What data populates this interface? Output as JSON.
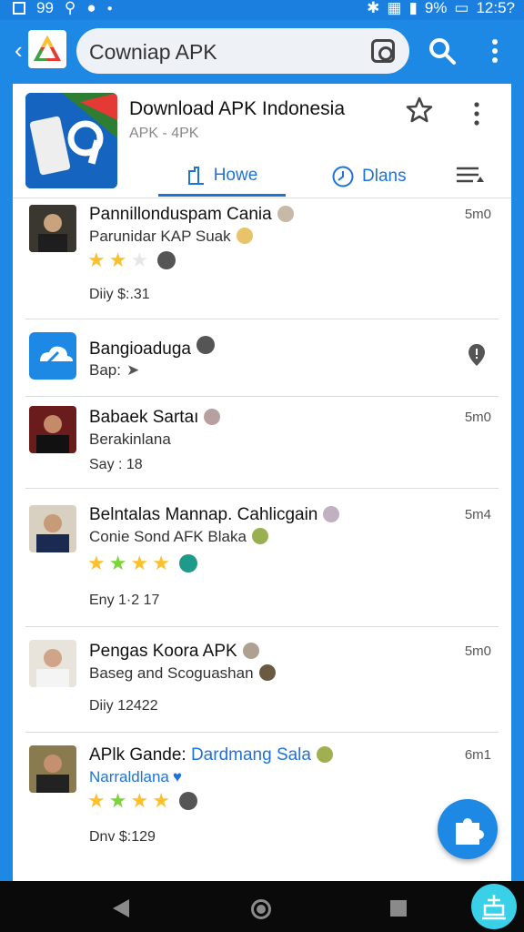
{
  "status_bar": {
    "notif_count": "99",
    "time": "12:5?",
    "battery": "9%"
  },
  "search": {
    "value": "Cowniap APK"
  },
  "app": {
    "title": "Download APK Indonesia",
    "subtitle": "APK - 4PK"
  },
  "tabs": [
    {
      "label": "Howe",
      "icon": "home-icon"
    },
    {
      "label": "Dlans",
      "icon": "clock-icon"
    }
  ],
  "items": [
    {
      "title": "Pannillonduspam Cania",
      "subtitle": "Parunidar KAP Suak",
      "meta": "Diiy $:.31",
      "time": "5m0",
      "stars": [
        "y",
        "y",
        "e"
      ]
    },
    {
      "title": "Bangioaduga",
      "subtitle": "Bap:",
      "meta": "",
      "time": "",
      "stars": []
    },
    {
      "title": "Babaek Sartaı",
      "subtitle": "Berakinlana",
      "meta": "Say : 18",
      "time": "5m0",
      "stars": []
    },
    {
      "title": "Belntalas Mannap. Cahlicgain",
      "subtitle": "Conie Sond AFK Blaka",
      "meta": "Eny 1·2 17",
      "time": "5m4",
      "stars": [
        "y",
        "g",
        "y",
        "y"
      ]
    },
    {
      "title": "Pengas Koora APK",
      "subtitle": "Baseg and Scoguashan",
      "meta": "Diiy 12422",
      "time": "5m0",
      "stars": []
    },
    {
      "title": "APlk Gande:",
      "title_accent": "Dardmang Sala",
      "subtitle": "Narraldlana",
      "meta": "Dnv $:129",
      "time": "6m1",
      "stars": [
        "y",
        "g",
        "y",
        "y"
      ]
    }
  ],
  "colors": {
    "primary": "#1e88e5",
    "accent_text": "#1e73d6",
    "star_yellow": "#fbc02d",
    "star_green": "#7cd43c"
  }
}
